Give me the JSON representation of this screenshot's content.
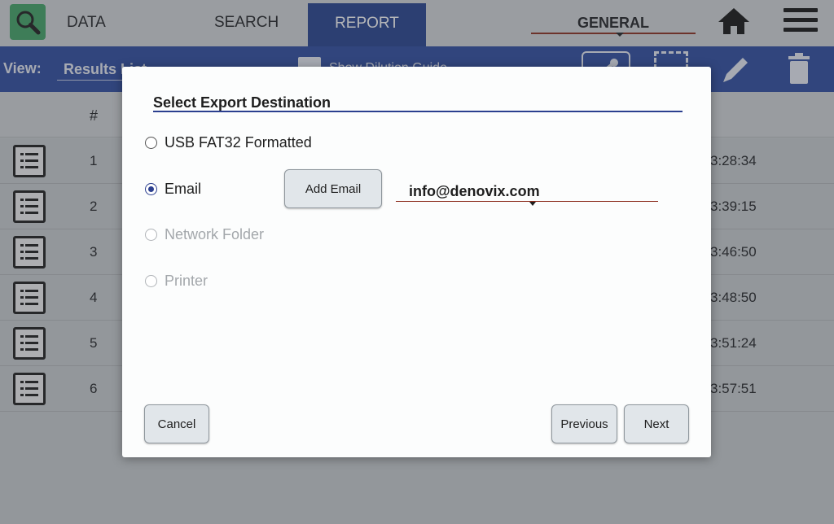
{
  "topbar": {
    "app_icon": "magnifier-icon",
    "tabs": [
      "DATA",
      "SEARCH",
      "REPORT"
    ],
    "active_tab": "REPORT",
    "profile": "GENERAL",
    "home_icon": "home-icon",
    "menu_icon": "hamburger-menu-icon"
  },
  "subbar": {
    "view_label": "View:",
    "view_value": "Results List",
    "overlay_text": "Show Dilution Guide",
    "share_icon": "share-icon",
    "select_icon": "select-all-icon",
    "edit_icon": "pencil-icon",
    "trash_icon": "trash-icon"
  },
  "table": {
    "col_hash": "#",
    "rows": [
      {
        "num": "1",
        "time": "3:28:34"
      },
      {
        "num": "2",
        "time": "3:39:15"
      },
      {
        "num": "3",
        "time": "3:46:50"
      },
      {
        "num": "4",
        "time": "3:48:50"
      },
      {
        "num": "5",
        "time": "3:51:24"
      },
      {
        "num": "6",
        "time": "3:57:51"
      }
    ]
  },
  "dialog": {
    "title": "Select Export Destination",
    "options": [
      {
        "label": "USB FAT32 Formatted",
        "selected": false,
        "enabled": true
      },
      {
        "label": "Email",
        "selected": true,
        "enabled": true
      },
      {
        "label": "Network Folder",
        "selected": false,
        "enabled": false
      },
      {
        "label": "Printer",
        "selected": false,
        "enabled": false
      }
    ],
    "add_email_label": "Add Email",
    "email_value": "info@denovix.com",
    "cancel_label": "Cancel",
    "previous_label": "Previous",
    "next_label": "Next"
  },
  "colors": {
    "accent": "#233f8f",
    "app_icon_bg": "#3fa364",
    "underline_accent": "#8c2c1c"
  }
}
